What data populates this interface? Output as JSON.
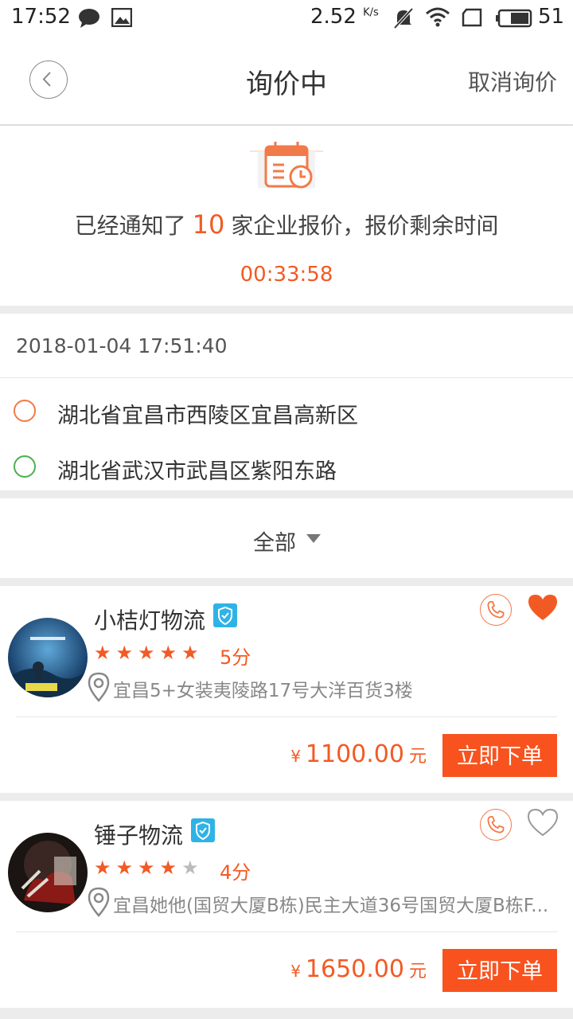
{
  "status_bar": {
    "time": "17:52",
    "speed": "2.52",
    "speed_unit": "K/s",
    "battery": "51"
  },
  "header": {
    "title": "询价中",
    "cancel_label": "取消询价"
  },
  "notice": {
    "prefix": "已经通知了",
    "count": "10",
    "suffix": "家企业报价，报价剩余时间",
    "countdown": "00:33:58"
  },
  "route": {
    "datetime": "2018-01-04 17:51:40",
    "origin": "湖北省宜昌市西陵区宜昌高新区",
    "destination": "湖北省武汉市武昌区紫阳东路"
  },
  "filter": {
    "label": "全部"
  },
  "quotes": [
    {
      "name": "小桔灯物流",
      "rating": 5,
      "score_label": "5分",
      "address": "宜昌5+女装夷陵路17号大洋百货3楼",
      "currency": "¥",
      "price": "1100.00",
      "unit": "元",
      "order_label": "立即下单",
      "favorited": true
    },
    {
      "name": "锤子物流",
      "rating": 4,
      "score_label": "4分",
      "address": "宜昌她他(国贸大厦B栋)民主大道36号国贸大厦B栋F...",
      "currency": "¥",
      "price": "1650.00",
      "unit": "元",
      "order_label": "立即下单",
      "favorited": false
    }
  ],
  "colors": {
    "accent": "#f25a24",
    "button": "#f8531f",
    "origin_dot": "#f27a4a",
    "dest_dot": "#4caf50",
    "verify": "#2fb3e6"
  }
}
